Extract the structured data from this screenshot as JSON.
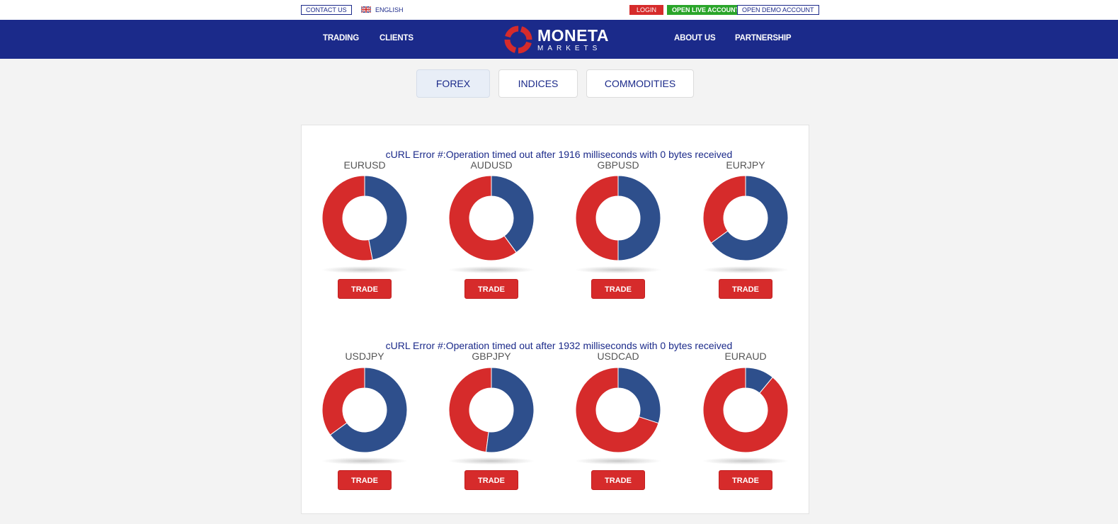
{
  "topbar": {
    "contact": "CONTACT US",
    "language": "ENGLISH",
    "login": "LOGIN",
    "open_live": "OPEN LIVE ACCOUNT",
    "open_demo": "OPEN DEMO ACCOUNT"
  },
  "nav": {
    "trading": "TRADING",
    "clients": "CLIENTS",
    "about": "ABOUT US",
    "partnership": "PARTNERSHIP",
    "logo_word1": "MONETA",
    "logo_word2": "MARKETS"
  },
  "tabs": [
    "FOREX",
    "INDICES",
    "COMMODITIES"
  ],
  "active_tab": "FOREX",
  "colors": {
    "blue": "#2e4f8c",
    "red": "#d62b2b",
    "navy": "#1b2a8a",
    "green": "#2aa52a"
  },
  "errors": [
    "cURL Error #:Operation timed out after 1916 milliseconds with 0 bytes received",
    "cURL Error #:Operation timed out after 1932 milliseconds with 0 bytes received"
  ],
  "trade_label": "TRADE",
  "pairs": [
    {
      "name": "EURUSD",
      "blue_fraction": 0.47
    },
    {
      "name": "AUDUSD",
      "blue_fraction": 0.4
    },
    {
      "name": "GBPUSD",
      "blue_fraction": 0.5
    },
    {
      "name": "EURJPY",
      "blue_fraction": 0.65
    },
    {
      "name": "USDJPY",
      "blue_fraction": 0.65
    },
    {
      "name": "GBPJPY",
      "blue_fraction": 0.52
    },
    {
      "name": "USDCAD",
      "blue_fraction": 0.3
    },
    {
      "name": "EURAUD",
      "blue_fraction": 0.11
    }
  ]
}
